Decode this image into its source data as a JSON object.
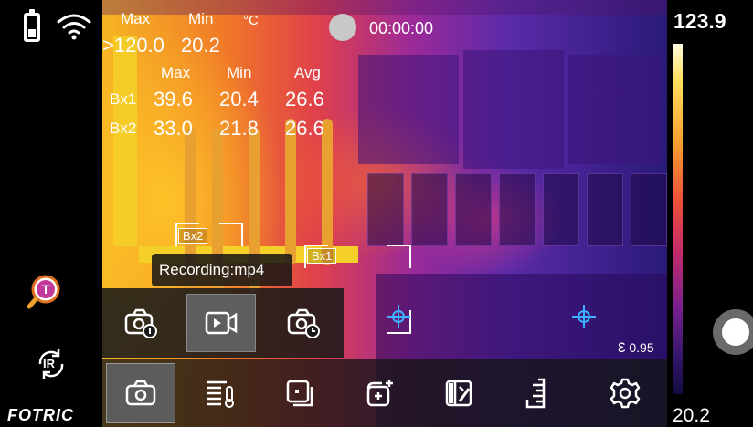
{
  "status": {
    "battery_icon": "battery-icon",
    "wifi_icon": "wifi-icon"
  },
  "spot": {
    "max_label": "Max",
    "min_label": "Min",
    "unit": "°C",
    "max_value": ">120.0",
    "min_value": "20.2"
  },
  "boxes_table": {
    "headers": [
      "Max",
      "Min",
      "Avg"
    ],
    "rows": [
      {
        "name": "Bx1",
        "max": "39.6",
        "min": "20.4",
        "avg": "26.6"
      },
      {
        "name": "Bx2",
        "max": "33.0",
        "min": "21.8",
        "avg": "26.6"
      }
    ]
  },
  "recording": {
    "timer": "00:00:00",
    "toast": "Recording:mp4"
  },
  "markers": {
    "bx1": "Bx1",
    "bx2": "Bx2"
  },
  "color_scale": {
    "max": "123.9",
    "min": "20.2",
    "colors": [
      "#fffbe0",
      "#ffe060",
      "#f7a030",
      "#ec5038",
      "#c02a6c",
      "#7a208e",
      "#3a1870",
      "#120a40"
    ]
  },
  "emissivity": {
    "symbol": "ε",
    "value": "0.95"
  },
  "brand": {
    "logo": "FOTRIC"
  },
  "capture_modes": [
    {
      "icon": "camera-info-icon",
      "selected": false
    },
    {
      "icon": "video-record-icon",
      "selected": true
    },
    {
      "icon": "camera-timer-icon",
      "selected": false
    }
  ],
  "toolbar": [
    {
      "icon": "camera-icon",
      "selected": true
    },
    {
      "icon": "thermometer-list-icon",
      "selected": false
    },
    {
      "icon": "image-frame-icon",
      "selected": false
    },
    {
      "icon": "add-measure-icon",
      "selected": false
    },
    {
      "icon": "palette-icon",
      "selected": false
    },
    {
      "icon": "ruler-icon",
      "selected": false
    },
    {
      "icon": "gear-icon",
      "selected": false
    }
  ],
  "side_buttons": {
    "app_icon": "fotric-app-icon",
    "ir_label": "IR"
  }
}
